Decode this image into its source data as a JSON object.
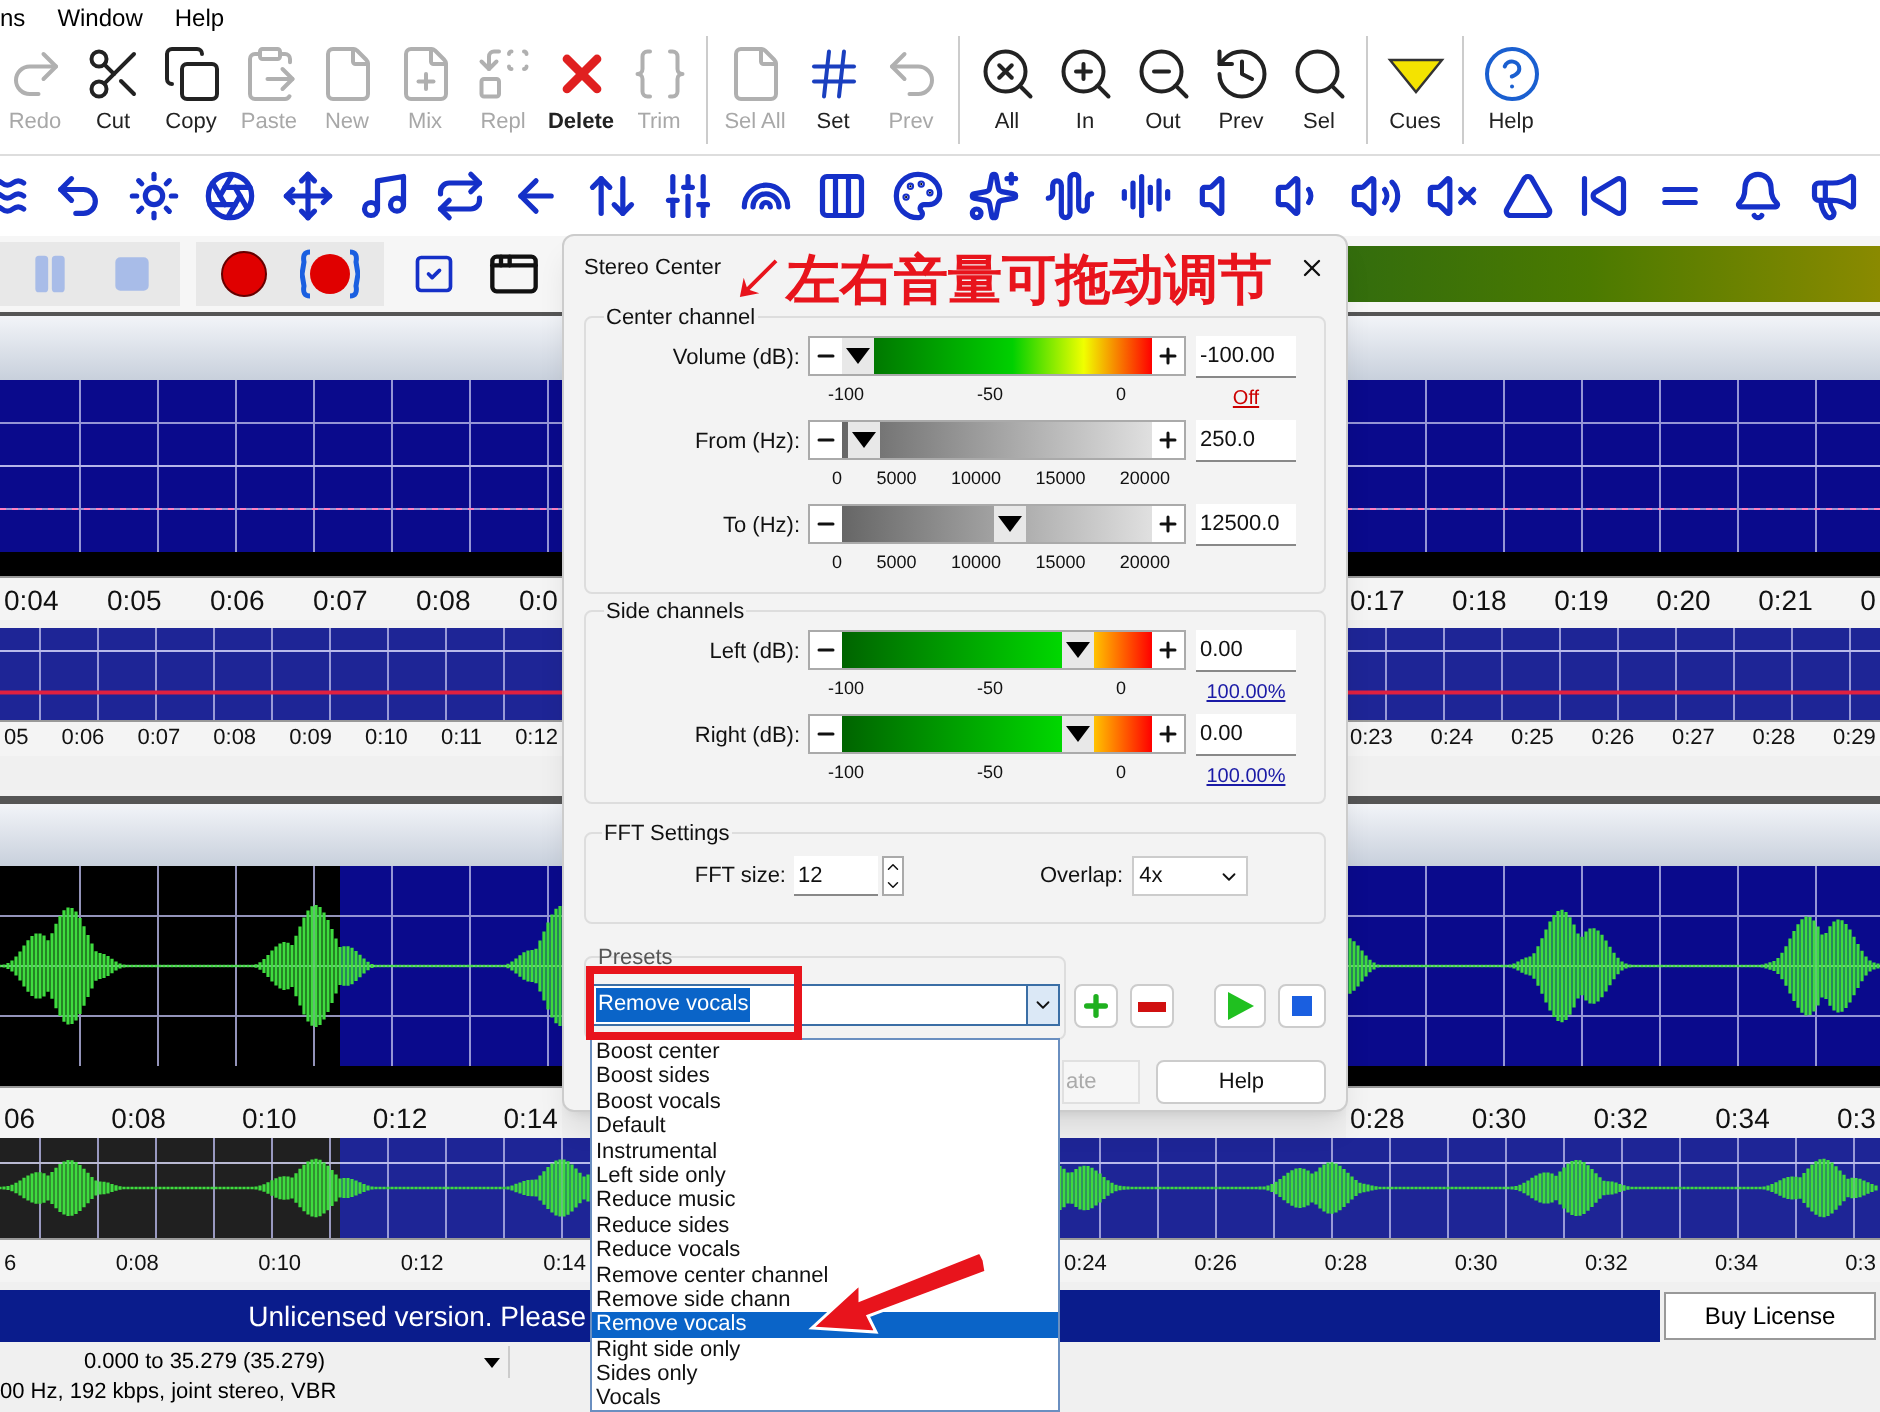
{
  "menu_bar": [
    "ns",
    "Window",
    "Help"
  ],
  "toolbar": {
    "groups": [
      [
        {
          "label": "Redo",
          "disabled": true
        },
        {
          "label": "Cut",
          "disabled": false
        },
        {
          "label": "Copy",
          "disabled": false
        },
        {
          "label": "Paste",
          "disabled": true
        },
        {
          "label": "New",
          "disabled": true
        },
        {
          "label": "Mix",
          "disabled": true
        },
        {
          "label": "Repl",
          "disabled": true
        },
        {
          "label": "Delete",
          "disabled": false
        },
        {
          "label": "Trim",
          "disabled": true
        }
      ],
      [
        {
          "label": "Sel All",
          "disabled": true
        },
        {
          "label": "Set",
          "disabled": false
        },
        {
          "label": "Prev",
          "disabled": true
        }
      ],
      [
        {
          "label": "All",
          "disabled": false
        },
        {
          "label": "In",
          "disabled": false
        },
        {
          "label": "Out",
          "disabled": false
        },
        {
          "label": "Prev",
          "disabled": false
        },
        {
          "label": "Sel",
          "disabled": false
        }
      ],
      [
        {
          "label": "Cues",
          "disabled": false
        }
      ],
      [
        {
          "label": "Help",
          "disabled": false
        }
      ]
    ]
  },
  "transport": [
    {
      "disabled": true
    },
    {
      "disabled": true
    },
    {
      "disabled": false
    },
    {
      "disabled": false
    }
  ],
  "tracks": [
    {
      "kind": "main",
      "audio": false,
      "left_ticks": [
        "0:04",
        "0:05",
        "0:06",
        "0:07",
        "0:08",
        "0:0"
      ],
      "right_ticks": [
        "0:17",
        "0:18",
        "0:19",
        "0:20",
        "0:21",
        "0"
      ]
    },
    {
      "kind": "overview",
      "audio": false,
      "left_ticks": [
        "05",
        "0:06",
        "0:07",
        "0:08",
        "0:09",
        "0:10",
        "0:11",
        "0:12"
      ],
      "right_ticks": [
        "0:23",
        "0:24",
        "0:25",
        "0:26",
        "0:27",
        "0:28",
        "0:29"
      ]
    },
    {
      "kind": "main",
      "audio": true,
      "left_ticks": [
        "06",
        "0:08",
        "0:10",
        "0:12",
        "0:14"
      ],
      "right_ticks": [
        "0:28",
        "0:30",
        "0:32",
        "0:34",
        "0:3"
      ]
    },
    {
      "kind": "overview",
      "audio": true,
      "left_ticks": [
        "6",
        "0:08",
        "0:10",
        "0:12",
        "0:14"
      ],
      "right_ticks": [
        "0:24",
        "0:26",
        "0:28",
        "0:30",
        "0:32",
        "0:34",
        "0:3"
      ]
    }
  ],
  "dialog": {
    "title": "Stereo Center",
    "groups": [
      {
        "legend": "Center channel",
        "sliders": [
          {
            "kind": "db",
            "label": "Volume (dB):",
            "level": 0,
            "value": "-100.00",
            "scale": [
              "-100",
              "-50",
              "0"
            ],
            "link": {
              "text": "Off",
              "color": "#cc0000"
            }
          },
          {
            "kind": "hz",
            "label": "From (Hz):",
            "level": 0.02,
            "value": "250.0",
            "scale": [
              "0",
              "5000",
              "10000",
              "15000",
              "20000"
            ]
          },
          {
            "kind": "hz",
            "label": "To (Hz):",
            "level": 0.55,
            "value": "12500.0",
            "scale": [
              "0",
              "5000",
              "10000",
              "15000",
              "20000"
            ]
          }
        ]
      },
      {
        "legend": "Side channels",
        "sliders": [
          {
            "kind": "side",
            "label": "Left (dB):",
            "level": 0.79,
            "value": "0.00",
            "scale": [
              "-100",
              "-50",
              "0"
            ],
            "link": {
              "text": "100.00%",
              "color": "#1a1aa6"
            }
          },
          {
            "kind": "side",
            "label": "Right (dB):",
            "level": 0.79,
            "value": "0.00",
            "scale": [
              "-100",
              "-50",
              "0"
            ],
            "link": {
              "text": "100.00%",
              "color": "#1a1aa6"
            }
          }
        ]
      }
    ],
    "fft": {
      "legend": "FFT Settings",
      "size_label": "FFT size:",
      "size": "12",
      "overlap_label": "Overlap:",
      "overlap": "4x"
    },
    "presets": {
      "legend": "Presets",
      "value": "Remove vocals"
    },
    "buttons": [
      "ate",
      "Help"
    ]
  },
  "preset_list": [
    {
      "label": "Boost center",
      "selected": false
    },
    {
      "label": "Boost sides",
      "selected": false
    },
    {
      "label": "Boost vocals",
      "selected": false
    },
    {
      "label": "Default",
      "selected": false
    },
    {
      "label": "Instrumental",
      "selected": false
    },
    {
      "label": "Left side only",
      "selected": false
    },
    {
      "label": "Reduce music",
      "selected": false
    },
    {
      "label": "Reduce sides",
      "selected": false
    },
    {
      "label": "Reduce vocals",
      "selected": false
    },
    {
      "label": "Remove center channel",
      "selected": false
    },
    {
      "label": "Remove side chann",
      "selected": false
    },
    {
      "label": "Remove vocals",
      "selected": true
    },
    {
      "label": "Right side only",
      "selected": false
    },
    {
      "label": "Sides only",
      "selected": false
    },
    {
      "label": "Vocals",
      "selected": false
    }
  ],
  "annotation": {
    "text": "↙左右音量可拖动调节"
  },
  "banner": {
    "text": "Unlicensed version. Please",
    "button": "Buy License"
  },
  "status": {
    "selection": "0.000 to 35.279 (35.279)",
    "format": "00 Hz, 192 kbps, joint stereo, VBR"
  }
}
